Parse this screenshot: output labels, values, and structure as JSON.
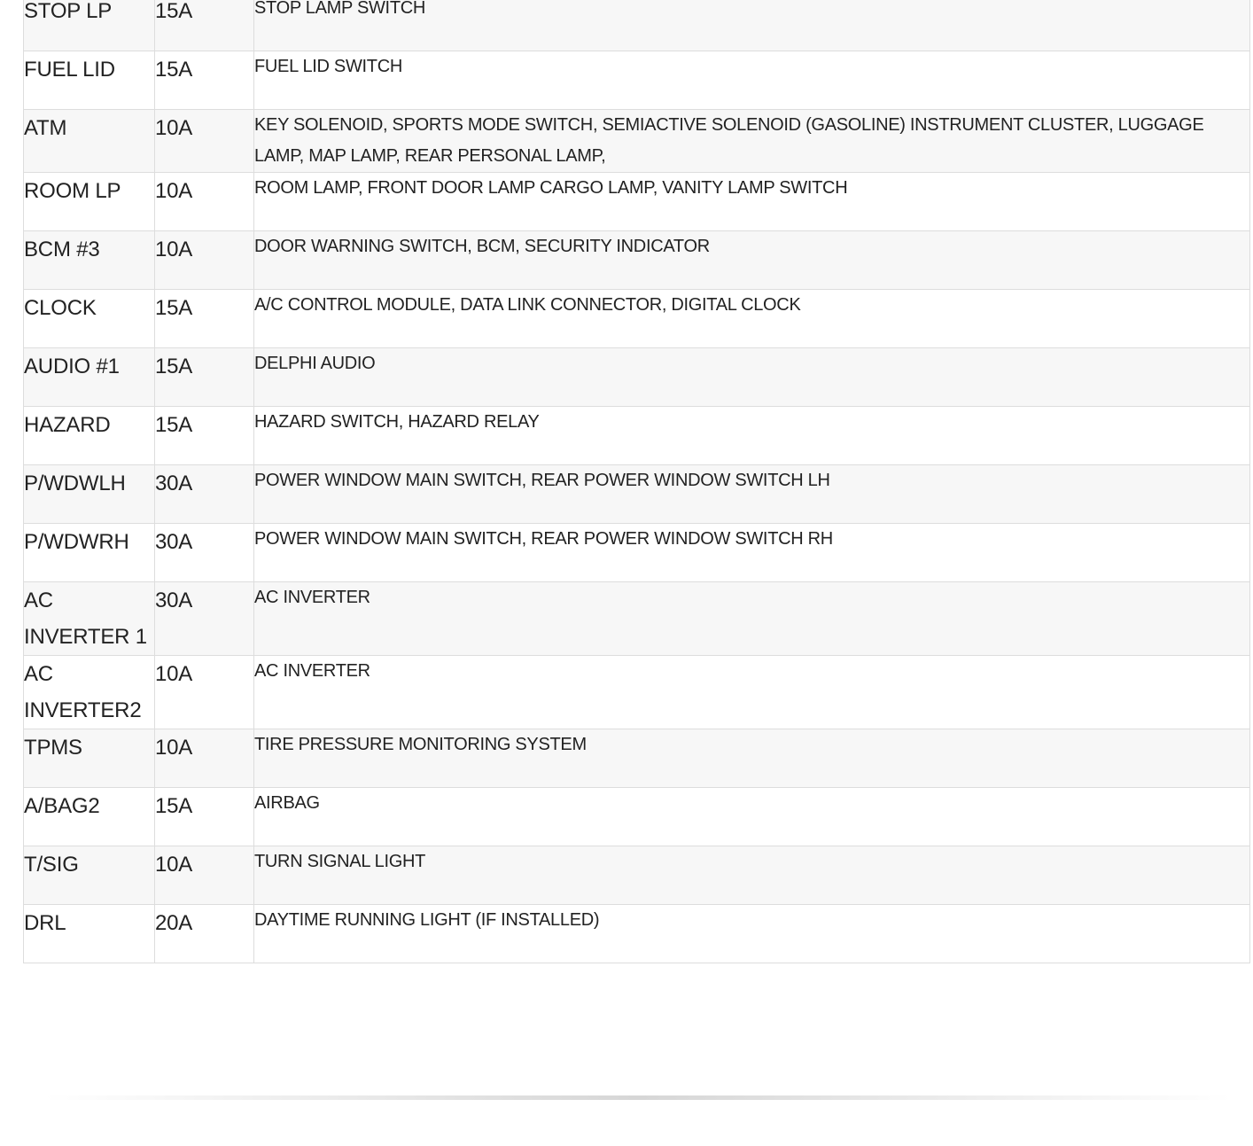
{
  "fuse_table": {
    "rows": [
      {
        "name": "STOP LP",
        "amp": "15A",
        "desc": "STOP LAMP SWITCH"
      },
      {
        "name": "FUEL LID",
        "amp": "15A",
        "desc": "FUEL LID SWITCH"
      },
      {
        "name": "ATM",
        "amp": "10A",
        "desc": "KEY SOLENOID, SPORTS MODE SWITCH, SEMIACTIVE SOLENOID (GASOLINE) INSTRUMENT CLUSTER, LUGGAGE LAMP, MAP LAMP, REAR PERSONAL LAMP,"
      },
      {
        "name": "ROOM LP",
        "amp": "10A",
        "desc": "ROOM LAMP, FRONT DOOR LAMP CARGO LAMP, VANITY LAMP SWITCH"
      },
      {
        "name": "BCM #3",
        "amp": "10A",
        "desc": "DOOR WARNING SWITCH, BCM, SECURITY INDICATOR"
      },
      {
        "name": "CLOCK",
        "amp": "15A",
        "desc": "A/C CONTROL MODULE, DATA LINK CONNECTOR, DIGITAL CLOCK"
      },
      {
        "name": "AUDIO #1",
        "amp": "15A",
        "desc": "DELPHI AUDIO"
      },
      {
        "name": "HAZARD",
        "amp": "15A",
        "desc": "HAZARD SWITCH, HAZARD RELAY"
      },
      {
        "name": "P/WDWLH",
        "amp": "30A",
        "desc": "POWER WINDOW MAIN SWITCH, REAR POWER WINDOW SWITCH LH"
      },
      {
        "name": "P/WDWRH",
        "amp": "30A",
        "desc": "POWER WINDOW MAIN SWITCH, REAR POWER WINDOW SWITCH RH"
      },
      {
        "name": "AC INVERTER 1",
        "amp": "30A",
        "desc": "AC INVERTER"
      },
      {
        "name": "AC INVERTER2",
        "amp": "10A",
        "desc": "AC INVERTER"
      },
      {
        "name": "TPMS",
        "amp": "10A",
        "desc": "TIRE PRESSURE MONITORING SYSTEM"
      },
      {
        "name": "A/BAG2",
        "amp": "15A",
        "desc": "AIRBAG"
      },
      {
        "name": "T/SIG",
        "amp": "10A",
        "desc": "TURN SIGNAL LIGHT"
      },
      {
        "name": "DRL",
        "amp": "20A",
        "desc": "DAYTIME RUNNING LIGHT (IF INSTALLED)"
      }
    ]
  }
}
